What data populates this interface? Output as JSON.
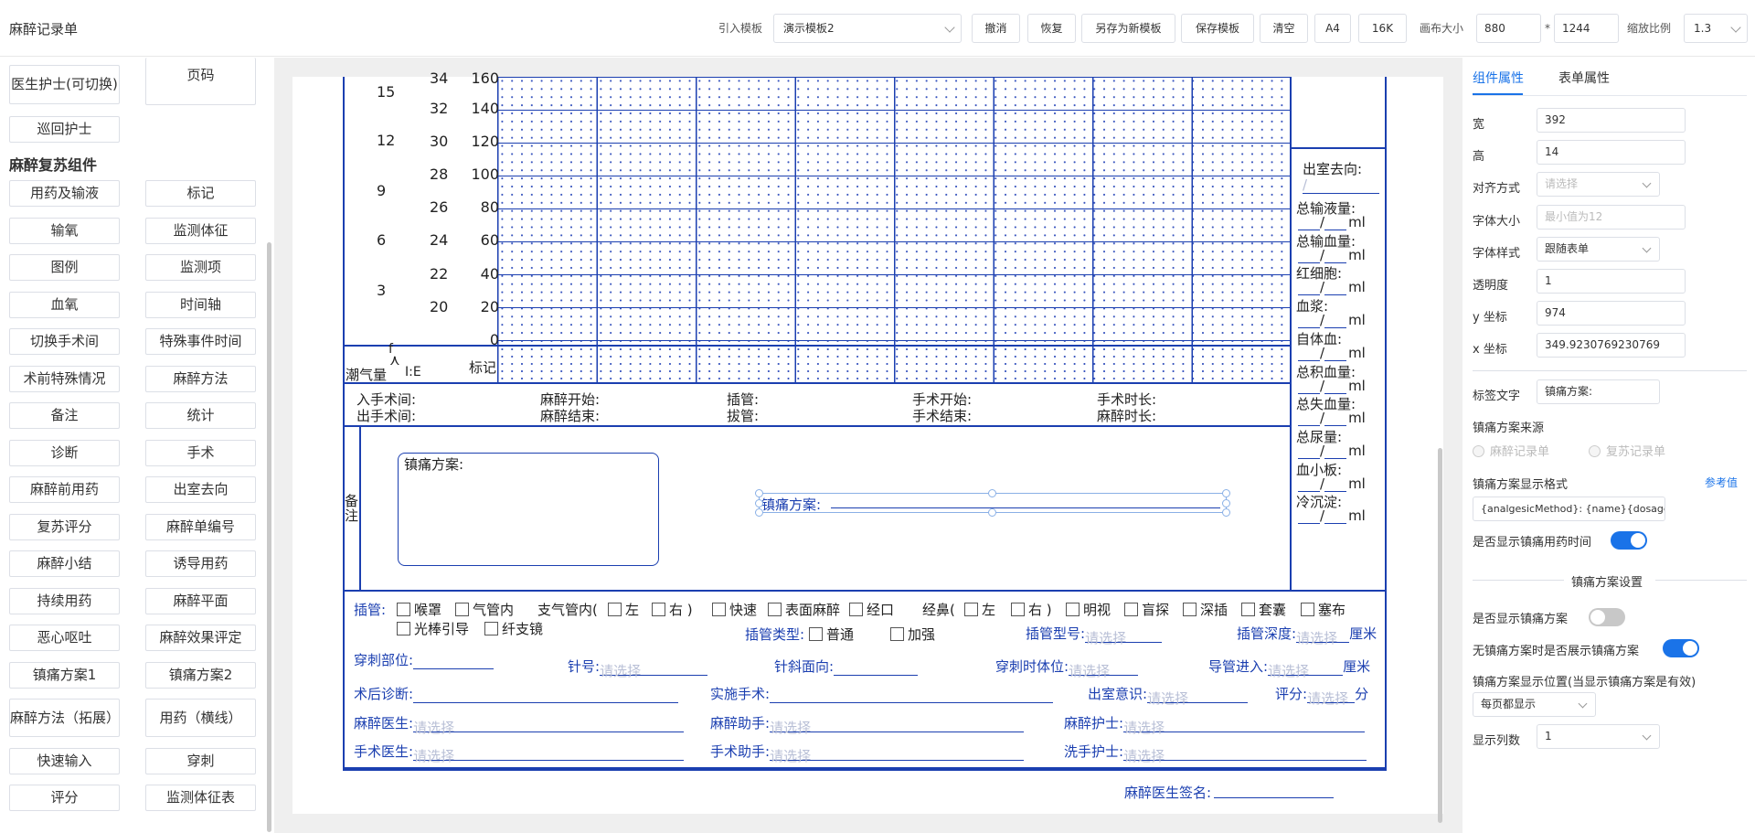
{
  "app_title": "麻醉记录单",
  "toolbar": {
    "template_label": "引入模板",
    "template_value": "演示模板2",
    "buttons": [
      "撤消",
      "恢复",
      "另存为新模板",
      "保存模板",
      "清空",
      "A4",
      "16K"
    ],
    "canvas_size_label": "画布大小",
    "canvas_width": "880",
    "times": "*",
    "canvas_height": "1244",
    "zoom_label": "缩放比例",
    "zoom_value": "1.3"
  },
  "left_panel": {
    "top_items": [
      "医生护士(可切换)",
      "页码",
      "巡回护士"
    ],
    "section_title": "麻醉复苏组件",
    "items": [
      "用药及输液",
      "标记",
      "输氧",
      "监测体征",
      "图例",
      "监测项",
      "血氧",
      "时间轴",
      "切换手术间",
      "特殊事件时间",
      "术前特殊情况",
      "麻醉方法",
      "备注",
      "统计",
      "诊断",
      "手术",
      "麻醉前用药",
      "出室去向",
      "复苏评分",
      "麻醉单编号",
      "麻醉小结",
      "诱导用药",
      "持续用药",
      "麻醉平面",
      "恶心呕吐",
      "麻醉效果评定",
      "镇痛方案1",
      "镇痛方案2",
      "麻醉方法（拓展）",
      "用药（横线）",
      "快速输入",
      "穿刺",
      "评分",
      "监测体征表"
    ]
  },
  "form": {
    "axis_col1": [
      "15",
      "12",
      "9",
      "6",
      "3"
    ],
    "axis_col2": [
      "34",
      "32",
      "30",
      "28",
      "26",
      "24",
      "22",
      "20"
    ],
    "axis_col3": [
      "160",
      "140",
      "120",
      "100",
      "80",
      "60",
      "40",
      "20",
      "0"
    ],
    "tidal_f": "f",
    "tidal_label": "潮气量",
    "tidal_ie": "I:E",
    "mark_label": "标记",
    "times_row1": [
      "入手术间:",
      "麻醉开始:",
      "插管:",
      "手术开始:",
      "手术时长:"
    ],
    "times_row2": [
      "出手术间:",
      "麻醉结束:",
      "拔管:",
      "手术结束:",
      "麻醉时长:"
    ],
    "remarks_label": "备注",
    "analgesia_box_label": "镇痛方案:",
    "analgesia_line_label": "镇痛方案:",
    "side_exit_label": "出室去向:",
    "side_exit_value": "/",
    "side_items": [
      "总输液量:",
      "总输血量:",
      "红细胞:",
      "血浆:",
      "自体血:",
      "总积血量:",
      "总失血量:",
      "总尿量:",
      "血小板:",
      "冷沉淀:"
    ],
    "side_unit": "ml",
    "side_slash": "/",
    "intub_label": "插管:",
    "intub_options_row1": [
      "喉罩",
      "气管内",
      "支气管内(",
      "左",
      "右 )",
      "快速",
      "表面麻醉",
      "经口",
      "经鼻(",
      "左",
      "右 )",
      "明视",
      "盲探",
      "深插",
      "套囊",
      "塞布"
    ],
    "intub_options_row2": [
      "光棒引导",
      "纤支镜"
    ],
    "intub_type_label": "插管类型:",
    "intub_type_options": [
      "普通",
      "加强"
    ],
    "intub_model_label": "插管型号:",
    "intub_depth_label": "插管深度:",
    "placeholder": "请选择",
    "unit_cm": "厘米",
    "puncture_site": "穿刺部位:",
    "needle": "针号:",
    "bevel": "针斜面向:",
    "puncture_pos": "穿刺时体位:",
    "catheter": "导管进入:",
    "postop_dx": "术后诊断:",
    "surgery_done": "实施手术:",
    "exit_consciousness": "出室意识:",
    "score": "评分:",
    "score_unit": "分",
    "anesth_doctor": "麻醉医生:",
    "anesth_assistant": "麻醉助手:",
    "anesth_nurse": "麻醉护士:",
    "surgeon": "手术医生:",
    "surg_assistant": "手术助手:",
    "scrub_nurse": "洗手护士:",
    "signature": "麻醉医生签名:"
  },
  "right_panel": {
    "tabs": [
      "组件属性",
      "表单属性"
    ],
    "width_label": "宽",
    "width_value": "392",
    "height_label": "高",
    "height_value": "14",
    "align_label": "对齐方式",
    "align_placeholder": "请选择",
    "fontsize_label": "字体大小",
    "fontsize_placeholder": "最小值为12",
    "fontstyle_label": "字体样式",
    "fontstyle_value": "跟随表单",
    "opacity_label": "透明度",
    "opacity_value": "1",
    "y_label": "y 坐标",
    "y_value": "974",
    "x_label": "x 坐标",
    "x_value": "349.9230769230769",
    "tag_text_label": "标签文字",
    "tag_text_value": "镇痛方案:",
    "source_label": "镇痛方案来源",
    "source_options": [
      "麻醉记录单",
      "复苏记录单"
    ],
    "format_label": "镇痛方案显示格式",
    "reference_link": "参考值",
    "format_value": "{analgesicMethod}: {name}{dosage",
    "show_time_label": "是否显示镇痛用药时间",
    "show_time_on": true,
    "settings_title": "镇痛方案设置",
    "show_plan_label": "是否显示镇痛方案",
    "show_plan_on": false,
    "show_when_none_label": "无镇痛方案时是否展示镇痛方案",
    "show_when_none_on": true,
    "position_label": "镇痛方案显示位置(当显示镇痛方案是有效)",
    "position_value": "每页都显示",
    "columns_label": "显示列数",
    "columns_value": "1",
    "accent": "#1a73e8",
    "toggle_off": "#c8c8c8"
  },
  "form_color": "#1b3fb0"
}
